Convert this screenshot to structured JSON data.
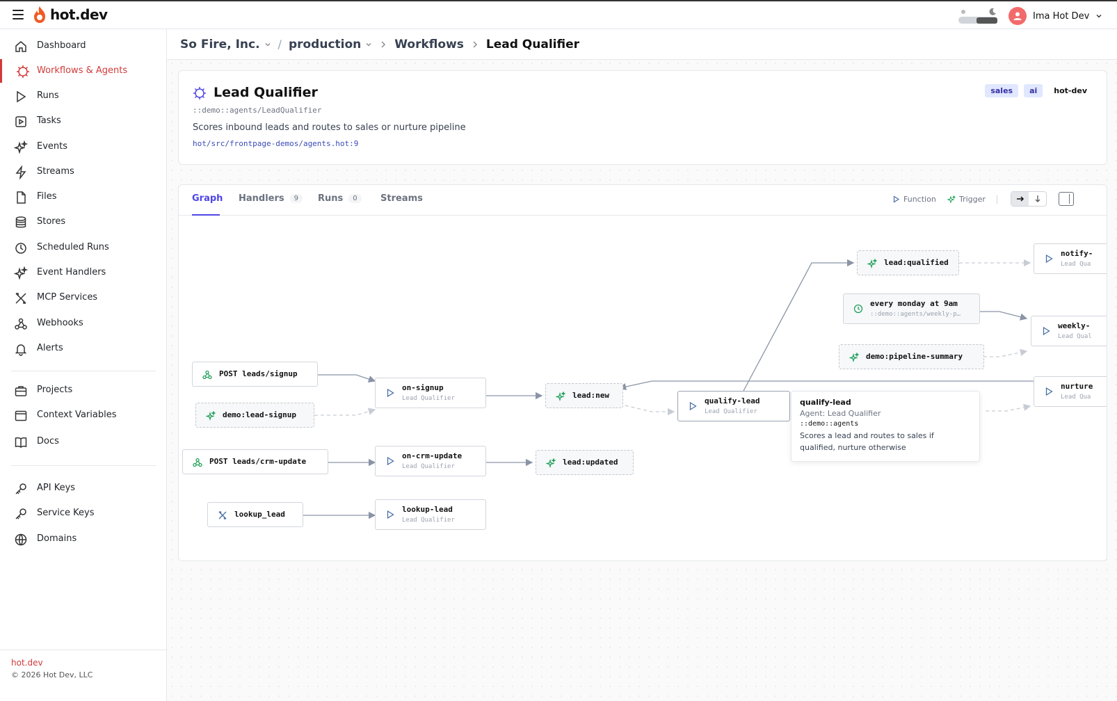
{
  "app": {
    "logo": "hot.dev"
  },
  "user": {
    "name": "Ima Hot Dev"
  },
  "sidebar": {
    "items": [
      {
        "label": "Dashboard"
      },
      {
        "label": "Workflows & Agents"
      },
      {
        "label": "Runs"
      },
      {
        "label": "Tasks"
      },
      {
        "label": "Events"
      },
      {
        "label": "Streams"
      },
      {
        "label": "Files"
      },
      {
        "label": "Stores"
      },
      {
        "label": "Scheduled Runs"
      },
      {
        "label": "Event Handlers"
      },
      {
        "label": "MCP Services"
      },
      {
        "label": "Webhooks"
      },
      {
        "label": "Alerts"
      },
      {
        "label": "Projects"
      },
      {
        "label": "Context Variables"
      },
      {
        "label": "Docs"
      },
      {
        "label": "API Keys"
      },
      {
        "label": "Service Keys"
      },
      {
        "label": "Domains"
      }
    ],
    "footer_link": "hot.dev",
    "footer_copy": "© 2026 Hot Dev, LLC"
  },
  "breadcrumb": {
    "org": "So Fire, Inc.",
    "env": "production",
    "section": "Workflows",
    "current": "Lead Qualifier"
  },
  "agent": {
    "title": "Lead Qualifier",
    "path": "::demo::agents/LeadQualifier",
    "description": "Scores inbound leads and routes to sales or nurture pipeline",
    "source": "hot/src/frontpage-demos/agents.hot:9",
    "tags": [
      "sales",
      "ai",
      "hot-dev"
    ]
  },
  "tabs": {
    "graph": "Graph",
    "handlers": "Handlers",
    "handlers_count": "9",
    "runs": "Runs",
    "runs_count": "0",
    "streams": "Streams"
  },
  "legend": {
    "function": "Function",
    "trigger": "Trigger"
  },
  "graph": {
    "nodes": {
      "post_signup": "POST leads/signup",
      "demo_lead_signup": "demo:lead-signup",
      "post_crm_update": "POST leads/crm-update",
      "lookup_lead_tool": "lookup_lead",
      "on_signup": "on-signup",
      "on_crm_update": "on-crm-update",
      "lookup_lead_fn": "lookup-lead",
      "lead_new": "lead:new",
      "lead_updated": "lead:updated",
      "qualify_lead": "qualify-lead",
      "lead_qualified": "lead:qualified",
      "every_monday": "every monday at 9am",
      "every_monday_sub": "::demo::agents/weekly-p…",
      "pipeline_summary": "demo:pipeline-summary",
      "notify": "notify-",
      "notify_sub": "Lead Qua",
      "weekly": "weekly-",
      "weekly_sub": "Lead Qual",
      "nurture": "nurture",
      "nurture_sub": "Lead Qua",
      "sub": "Lead Qualifier"
    }
  },
  "tooltip": {
    "title": "qualify-lead",
    "agent": "Agent: Lead Qualifier",
    "namespace": "::demo::agents",
    "description": "Scores a lead and routes to sales if qualified, nurture otherwise"
  },
  "colors": {
    "accent": "#d23a3a",
    "tab_active": "#4f46e5",
    "trigger": "#22a05a",
    "function": "#4a6fa5"
  }
}
